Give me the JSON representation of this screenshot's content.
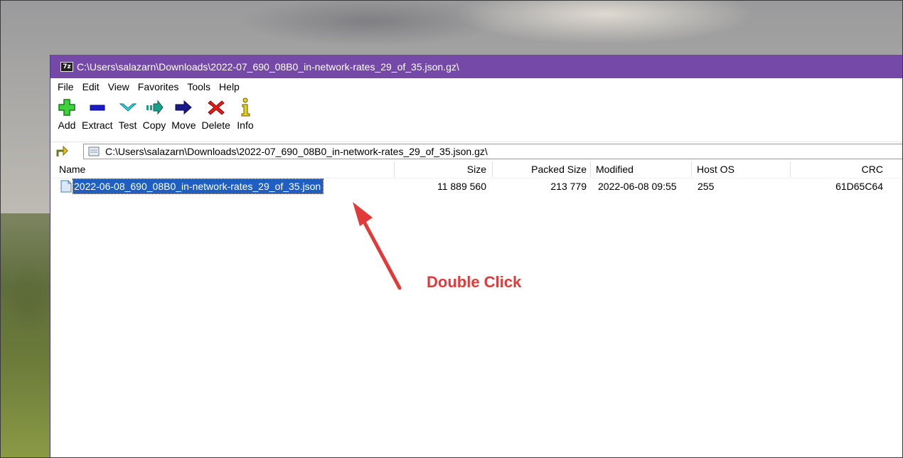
{
  "window": {
    "title": "C:\\Users\\salazarn\\Downloads\\2022-07_690_08B0_in-network-rates_29_of_35.json.gz\\",
    "app_icon_text": "7z"
  },
  "menu": [
    "File",
    "Edit",
    "View",
    "Favorites",
    "Tools",
    "Help"
  ],
  "toolbar": [
    {
      "label": "Add",
      "icon": "add-icon"
    },
    {
      "label": "Extract",
      "icon": "extract-icon"
    },
    {
      "label": "Test",
      "icon": "test-icon"
    },
    {
      "label": "Copy",
      "icon": "copy-icon"
    },
    {
      "label": "Move",
      "icon": "move-icon"
    },
    {
      "label": "Delete",
      "icon": "delete-icon"
    },
    {
      "label": "Info",
      "icon": "info-icon"
    }
  ],
  "address": {
    "path": "C:\\Users\\salazarn\\Downloads\\2022-07_690_08B0_in-network-rates_29_of_35.json.gz\\"
  },
  "columns": [
    "Name",
    "Size",
    "Packed Size",
    "Modified",
    "Host OS",
    "CRC"
  ],
  "rows": [
    {
      "name": "2022-06-08_690_08B0_in-network-rates_29_of_35.json",
      "size": "11 889 560",
      "packed_size": "213 779",
      "modified": "2022-06-08 09:55",
      "host_os": "255",
      "crc": "61D65C64",
      "selected": true
    }
  ],
  "annotation": {
    "text": "Double Click",
    "color": "#e23a3a"
  },
  "colors": {
    "titlebar": "#7549a8",
    "selection": "#1f5fc4"
  }
}
